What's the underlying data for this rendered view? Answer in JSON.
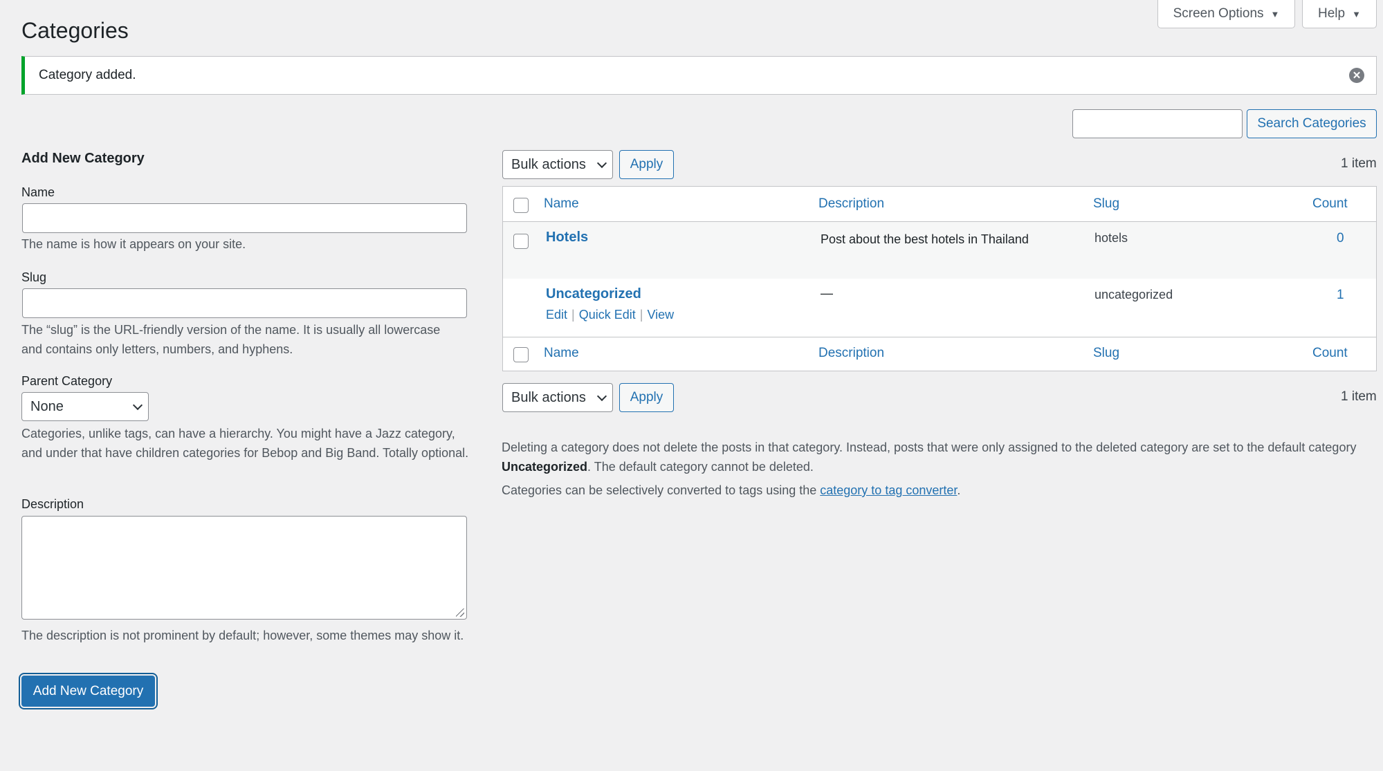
{
  "header": {
    "screen_options_label": "Screen Options",
    "help_label": "Help",
    "title": "Categories"
  },
  "notice": {
    "message": "Category added."
  },
  "search": {
    "input_value": "",
    "button_label": "Search Categories"
  },
  "form": {
    "heading": "Add New Category",
    "name_label": "Name",
    "name_value": "",
    "name_help": "The name is how it appears on your site.",
    "slug_label": "Slug",
    "slug_value": "",
    "slug_help": "The “slug” is the URL-friendly version of the name. It is usually all lowercase and contains only letters, numbers, and hyphens.",
    "parent_label": "Parent Category",
    "parent_selected": "None",
    "parent_help": "Categories, unlike tags, can have a hierarchy. You might have a Jazz category, and under that have children categories for Bebop and Big Band. Totally optional.",
    "description_label": "Description",
    "description_value": "",
    "description_help": "The description is not prominent by default; however, some themes may show it.",
    "submit_label": "Add New Category"
  },
  "tablenav_top": {
    "bulk_selected": "Bulk actions",
    "apply_label": "Apply",
    "item_count": "1 item"
  },
  "tablenav_bottom": {
    "bulk_selected": "Bulk actions",
    "apply_label": "Apply",
    "item_count": "1 item"
  },
  "table": {
    "columns": {
      "name": "Name",
      "description": "Description",
      "slug": "Slug",
      "count": "Count"
    },
    "rows": [
      {
        "name": "Hotels",
        "description": "Post about the best hotels in Thailand",
        "slug": "hotels",
        "count": "0"
      },
      {
        "name": "Uncategorized",
        "description": "—",
        "slug": "uncategorized",
        "count": "1",
        "actions": {
          "edit": "Edit",
          "quick_edit": "Quick Edit",
          "view": "View",
          "separator": "|"
        }
      }
    ]
  },
  "notes": {
    "delete_note_part1": "Deleting a category does not delete the posts in that category. Instead, posts that were only assigned to the deleted category are set to the default category ",
    "delete_note_bold": "Uncategorized",
    "delete_note_part2": ". The default category cannot be deleted.",
    "convert_note_part1": "Categories can be selectively converted to tags using the ",
    "convert_link": "category to tag converter",
    "convert_note_part2": "."
  },
  "colors": {
    "accent": "#2271b1",
    "success_border": "#00a32a",
    "background": "#f0f0f1"
  }
}
